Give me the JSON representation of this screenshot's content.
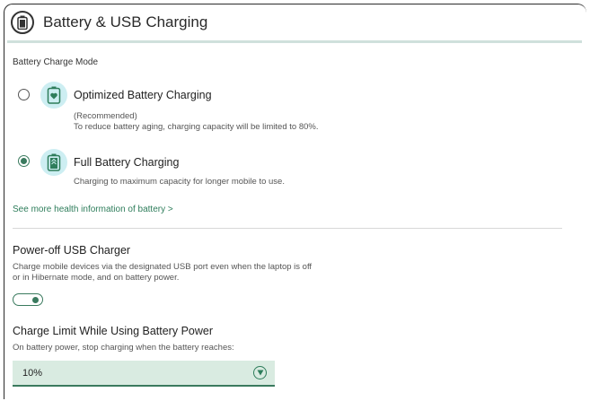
{
  "header": {
    "title": "Battery & USB Charging",
    "icon": "battery-icon"
  },
  "charge_mode": {
    "label": "Battery Charge Mode",
    "options": [
      {
        "title": "Optimized Battery Charging",
        "desc_line1": "(Recommended)",
        "desc_line2": "To reduce battery aging, charging capacity will be limited to 80%.",
        "selected": false,
        "icon": "battery-heart-icon"
      },
      {
        "title": "Full Battery Charging",
        "desc_line1": "Charging to maximum capacity for longer mobile to use.",
        "selected": true,
        "icon": "battery-full-icon"
      }
    ],
    "link": "See more health information of battery >"
  },
  "usb_charger": {
    "title": "Power-off USB Charger",
    "desc_line1": "Charge mobile devices via the designated USB port even when the laptop is off",
    "desc_line2": "or in Hibernate mode, and on battery power.",
    "toggle_on": true
  },
  "charge_limit": {
    "title": "Charge Limit While Using Battery Power",
    "desc": "On battery power, stop charging when the battery reaches:",
    "selected_value": "10%"
  },
  "colors": {
    "accent": "#3a7a5e",
    "icon_bg": "#cdeef2",
    "select_bg": "#d9ebe1"
  }
}
